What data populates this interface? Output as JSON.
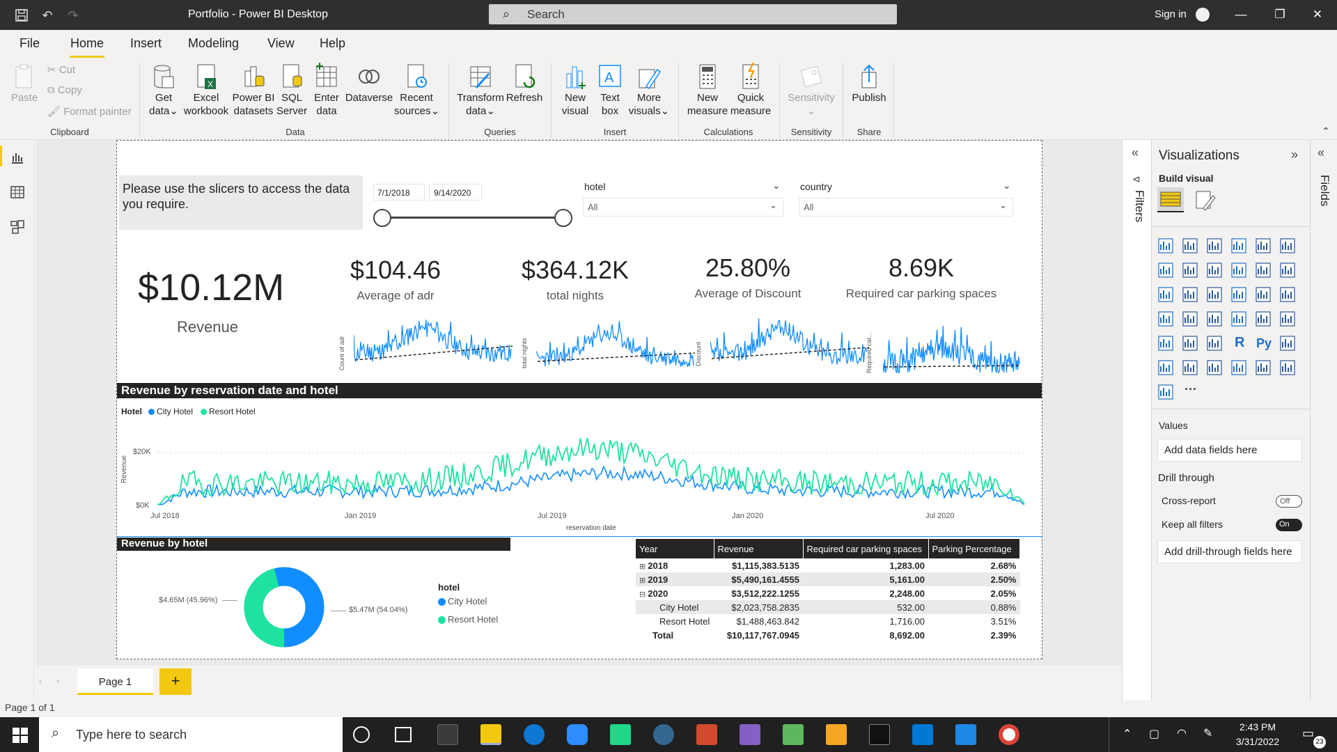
{
  "window": {
    "title": "Portfolio - Power BI Desktop",
    "search_placeholder": "Search",
    "sign_in": "Sign in"
  },
  "menu": [
    "File",
    "Home",
    "Insert",
    "Modeling",
    "View",
    "Help"
  ],
  "ribbon": {
    "clipboard": {
      "paste": "Paste",
      "cut": "Cut",
      "copy": "Copy",
      "format_painter": "Format painter",
      "group": "Clipboard"
    },
    "data": {
      "get_data": [
        "Get",
        "data"
      ],
      "excel": [
        "Excel",
        "workbook"
      ],
      "pbi": [
        "Power BI",
        "datasets"
      ],
      "sql": [
        "SQL",
        "Server"
      ],
      "enter": [
        "Enter",
        "data"
      ],
      "dataverse": "Dataverse",
      "recent": [
        "Recent",
        "sources"
      ],
      "group": "Data"
    },
    "queries": {
      "transform": [
        "Transform",
        "data"
      ],
      "refresh": "Refresh",
      "group": "Queries"
    },
    "insert": {
      "new_visual": [
        "New",
        "visual"
      ],
      "text_box": [
        "Text",
        "box"
      ],
      "more_visuals": [
        "More",
        "visuals"
      ],
      "group": "Insert"
    },
    "calculations": {
      "new_measure": [
        "New",
        "measure"
      ],
      "quick_measure": [
        "Quick",
        "measure"
      ],
      "group": "Calculations"
    },
    "sensitivity": {
      "label": "Sensitivity",
      "group": "Sensitivity"
    },
    "share": {
      "publish": "Publish",
      "group": "Share"
    }
  },
  "report": {
    "instruction": "Please use the slicers to access the data you require.",
    "date_start": "7/1/2018",
    "date_end": "9/14/2020",
    "hotel_slicer": {
      "title": "hotel",
      "value": "All"
    },
    "country_slicer": {
      "title": "country",
      "value": "All"
    },
    "kpis": {
      "revenue": {
        "value": "$10.12M",
        "label": "Revenue"
      },
      "adr": {
        "value": "$104.46",
        "label": "Average of adr",
        "axis": "Count of adr"
      },
      "nights": {
        "value": "$364.12K",
        "label": "total nights",
        "axis": "total nights"
      },
      "discount": {
        "value": "25.80%",
        "label": "Average of Discount",
        "axis": "Discount"
      },
      "parking": {
        "value": "8.69K",
        "label": "Required car parking spaces",
        "axis": "Required car..."
      }
    },
    "line_chart": {
      "title": "Revenue by reservation date and hotel",
      "legend_title": "Hotel",
      "legend": [
        "City Hotel",
        "Resort Hotel"
      ],
      "y_label": "Revenue",
      "y_ticks": [
        "$20K",
        "$0K"
      ],
      "x_ticks": [
        "Jul 2018",
        "Jan 2019",
        "Jul 2019",
        "Jan 2020",
        "Jul 2020"
      ],
      "x_label": "reservation date"
    },
    "donut": {
      "title": "Revenue by hotel",
      "legend_title": "hotel",
      "legend": [
        "City Hotel",
        "Resort Hotel"
      ],
      "label_left": "$4.65M (45.96%)",
      "label_right": "$5.47M (54.04%)"
    },
    "matrix": {
      "headers": [
        "Year",
        "Revenue",
        "Required car parking spaces",
        "Parking Percentage"
      ],
      "rows": [
        {
          "year": "2018",
          "revenue": "$1,115,383.5135",
          "parking": "1,283.00",
          "pct": "2.68%"
        },
        {
          "year": "2019",
          "revenue": "$5,490,161.4555",
          "parking": "5,161.00",
          "pct": "2.50%"
        },
        {
          "year": "2020",
          "revenue": "$3,512,222.1255",
          "parking": "2,248.00",
          "pct": "2.05%"
        },
        {
          "year": "City Hotel",
          "revenue": "$2,023,758.2835",
          "parking": "532.00",
          "pct": "0.88%"
        },
        {
          "year": "Resort Hotel",
          "revenue": "$1,488,463.842",
          "parking": "1,716.00",
          "pct": "3.51%"
        },
        {
          "year": "Total",
          "revenue": "$10,117,767.0945",
          "parking": "8,692.00",
          "pct": "2.39%"
        }
      ]
    }
  },
  "chart_data": {
    "type": "pie",
    "title": "Revenue by hotel",
    "categories": [
      "City Hotel",
      "Resort Hotel"
    ],
    "values": [
      5.47,
      4.65
    ],
    "units": "$M",
    "percent": [
      54.04,
      45.96
    ]
  },
  "viz_pane": {
    "title": "Visualizations",
    "build": "Build visual",
    "values": "Values",
    "add_data": "Add data fields here",
    "drill": "Drill through",
    "cross_report": "Cross-report",
    "cross_toggle": "Off",
    "keep_filters": "Keep all filters",
    "keep_toggle": "On",
    "add_drill": "Add drill-through fields here"
  },
  "filters_label": "Filters",
  "fields_label": "Fields",
  "page_tab": "Page 1",
  "status": "Page 1 of 1",
  "taskbar": {
    "search": "Type here to search",
    "time": "2:43 PM",
    "date": "3/31/2022",
    "notif": "23"
  },
  "colors": {
    "city": "#118dff",
    "resort": "#1ee3a0",
    "header": "#252423",
    "accent": "#f2c811"
  }
}
